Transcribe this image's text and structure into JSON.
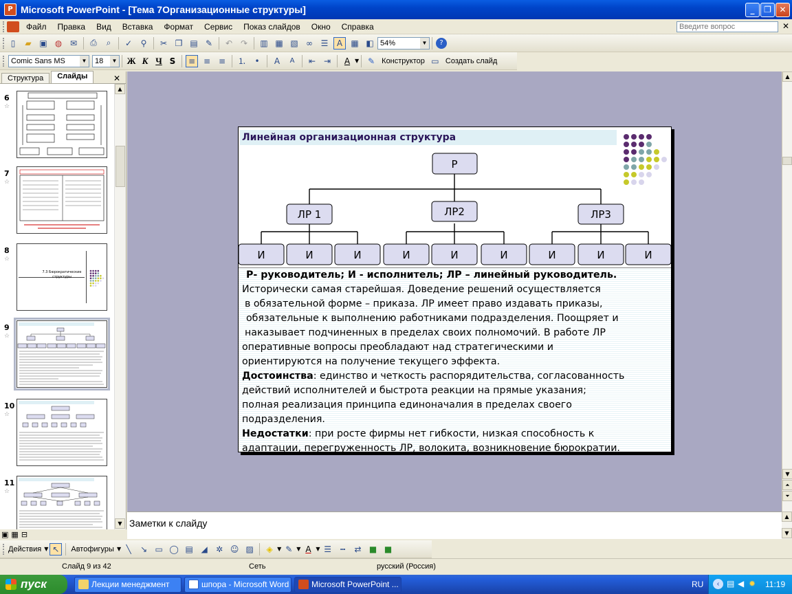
{
  "window": {
    "title": "Microsoft PowerPoint - [Тема 7Организационные структуры]"
  },
  "menu": {
    "items": [
      "Файл",
      "Правка",
      "Вид",
      "Вставка",
      "Формат",
      "Сервис",
      "Показ слайдов",
      "Окно",
      "Справка"
    ],
    "ask_placeholder": "Введите вопрос"
  },
  "toolbar_standard": {
    "zoom": "54%"
  },
  "toolbar_format": {
    "font": "Comic Sans MS",
    "size": "18",
    "bold": "Ж",
    "italic": "К",
    "underline": "Ч",
    "shadow": "S",
    "designer": "Конструктор",
    "new_slide": "Создать слайд"
  },
  "left_pane": {
    "tabs": [
      "Структура",
      "Слайды"
    ],
    "close": "✕",
    "thumbnails": [
      {
        "number": "6"
      },
      {
        "number": "7"
      },
      {
        "number": "8"
      },
      {
        "number": "9",
        "selected": true
      },
      {
        "number": "10"
      },
      {
        "number": "11"
      }
    ]
  },
  "slide": {
    "title": "Линейная организационная структура",
    "org": {
      "top": "Р",
      "managers": [
        "ЛР 1",
        "ЛР2",
        "ЛР3"
      ],
      "executor": "И"
    },
    "text": {
      "legend": "Р- руководитель; И -  исполнитель; ЛР – линейный руководитель.",
      "para1": [
        "Исторически самая старейшая.  Доведение решений осуществляется",
        "в обязательной форме – приказа. ЛР имеет право издавать приказы,",
        "обязательные к выполнению работниками подразделения. Поощряет и",
        "наказывает подчиненных в пределах своих полномочий. В работе ЛР",
        "оперативные вопросы преобладают над стратегическими и",
        "ориентируются на получение текущего эффекта."
      ],
      "adv_label": "Достоинства",
      "adv": [
        ": единство и четкость распорядительства, согласованность",
        "действий исполнителей и быстрота реакции на прямые указания;",
        "полная реализация принципа единоначалия в пределах своего",
        "подразделения."
      ],
      "dis_label": "Недостатки",
      "dis": [
        ": при росте фирмы нет гибкости, низкая способность к",
        "адаптации, перегруженность ЛР, волокита, возникновение бюрократии."
      ]
    }
  },
  "thumb_texts": {
    "slide8": "7.3 Бюрократические структуры"
  },
  "notes": {
    "placeholder": "Заметки к слайду"
  },
  "drawing": {
    "actions": "Действия",
    "autoshapes": "Автофигуры"
  },
  "status": {
    "slide": "Слайд 9 из 42",
    "design": "Сеть",
    "language": "русский (Россия)"
  },
  "taskbar": {
    "start": "пуск",
    "tasks": [
      "Лекции менеджмент",
      "шпора - Microsoft Word",
      "Microsoft PowerPoint ..."
    ],
    "lang": "RU",
    "time": "11:19"
  },
  "colors": {
    "accent": "#2a1659",
    "dots": [
      "#5b2c6f",
      "#7fa6a8",
      "#c6c92a",
      "#d8d5ec"
    ]
  }
}
